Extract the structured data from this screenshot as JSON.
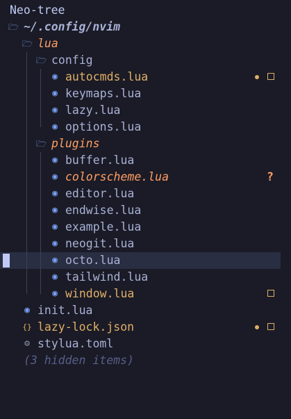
{
  "panel": {
    "title": "Neo-tree"
  },
  "tree": {
    "root": {
      "label": "~/.config/nvim"
    },
    "lua_folder": {
      "label": "lua"
    },
    "config_folder": {
      "label": "config"
    },
    "config_files": [
      {
        "label": "autocmds.lua",
        "status": "modified"
      },
      {
        "label": "keymaps.lua",
        "status": ""
      },
      {
        "label": "lazy.lua",
        "status": ""
      },
      {
        "label": "options.lua",
        "status": ""
      }
    ],
    "plugins_folder": {
      "label": "plugins"
    },
    "plugin_files": [
      {
        "label": "buffer.lua",
        "status": ""
      },
      {
        "label": "colorscheme.lua",
        "status": "untracked",
        "status_symbol": "?"
      },
      {
        "label": "editor.lua",
        "status": ""
      },
      {
        "label": "endwise.lua",
        "status": ""
      },
      {
        "label": "example.lua",
        "status": ""
      },
      {
        "label": "neogit.lua",
        "status": ""
      },
      {
        "label": "octo.lua",
        "status": ""
      },
      {
        "label": "tailwind.lua",
        "status": ""
      },
      {
        "label": "window.lua",
        "status": "modified"
      }
    ],
    "root_files": [
      {
        "label": "init.lua",
        "icon": "lua-icon",
        "status": ""
      },
      {
        "label": "lazy-lock.json",
        "icon": "json-icon",
        "status": "modified"
      },
      {
        "label": "stylua.toml",
        "icon": "gear-icon",
        "status": ""
      }
    ],
    "hidden": {
      "label": "(3 hidden items)"
    }
  },
  "colors": {
    "background": "#1a1b26",
    "cursor_line": "#292e42",
    "folder": "#7aa2f7",
    "modified": "#e0af68",
    "untracked": "#ff9e64",
    "hidden": "#565f89"
  },
  "icons": {
    "folder": "▸ folder-open-icon",
    "lua": "lua-icon",
    "json": "json-braces-icon",
    "toml": "gear-icon"
  }
}
